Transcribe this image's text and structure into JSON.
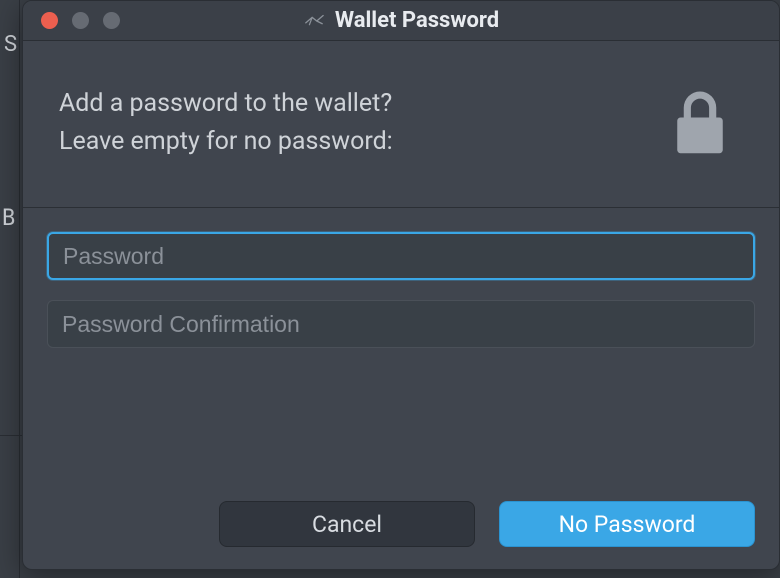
{
  "window": {
    "title": "Wallet Password"
  },
  "prompt": {
    "line1": "Add a password to the wallet?",
    "line2": "Leave empty for no password:"
  },
  "inputs": {
    "password": {
      "placeholder": "Password",
      "value": ""
    },
    "confirmation": {
      "placeholder": "Password Confirmation",
      "value": ""
    }
  },
  "buttons": {
    "cancel": "Cancel",
    "noPassword": "No Password"
  },
  "background": {
    "letterS": "S",
    "letterB": "B"
  }
}
